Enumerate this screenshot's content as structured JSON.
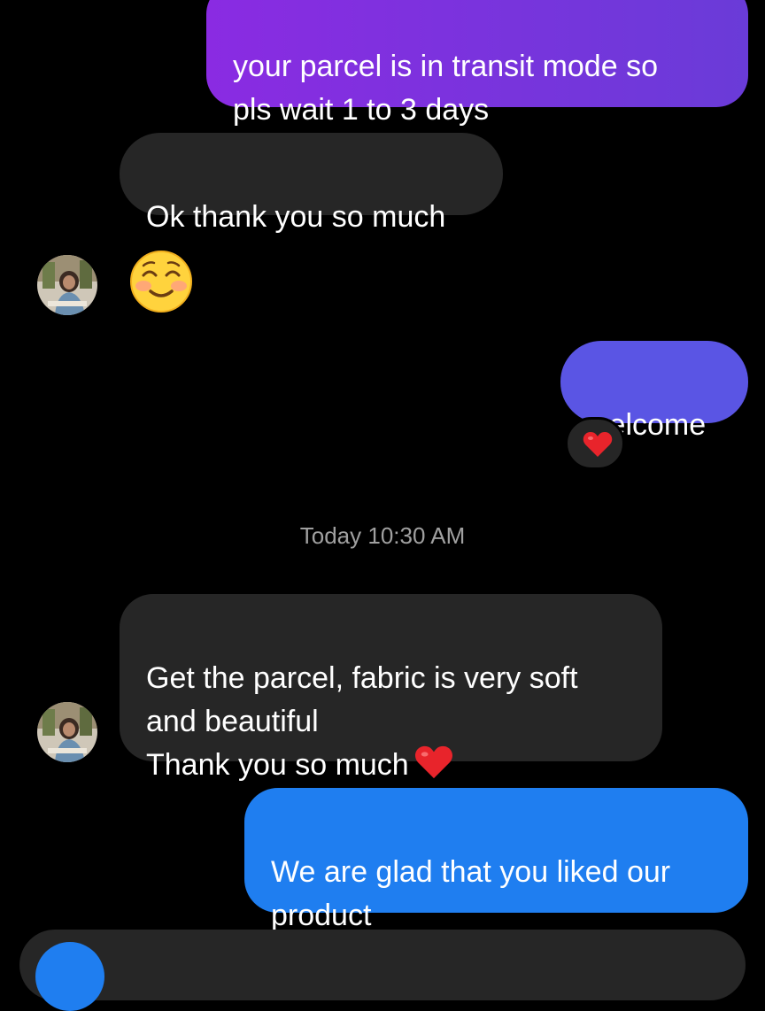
{
  "conversation": {
    "messages": [
      {
        "sender": "me",
        "text": "your parcel is in transit mode so\npls wait  1 to 3 days"
      },
      {
        "sender": "them",
        "text": "Ok thank you so much"
      },
      {
        "sender": "them",
        "emoji": "smiling-face-icon"
      },
      {
        "sender": "me",
        "text": "welcome",
        "reaction": "red-heart-icon"
      },
      {
        "sender": "them",
        "text": "Get the parcel, fabric is very soft\nand beautiful\nThank you so much",
        "trailing_emoji": "red-heart-icon"
      },
      {
        "sender": "me",
        "text": "We are glad that you liked our\nproduct"
      }
    ],
    "timestamp": "Today 10:30 AM"
  },
  "colors": {
    "sent_gradient_start": "#8a2be2",
    "sent_mid": "#5a55e4",
    "sent_blue": "#1f7ef0",
    "received": "#262626",
    "background": "#000000"
  }
}
